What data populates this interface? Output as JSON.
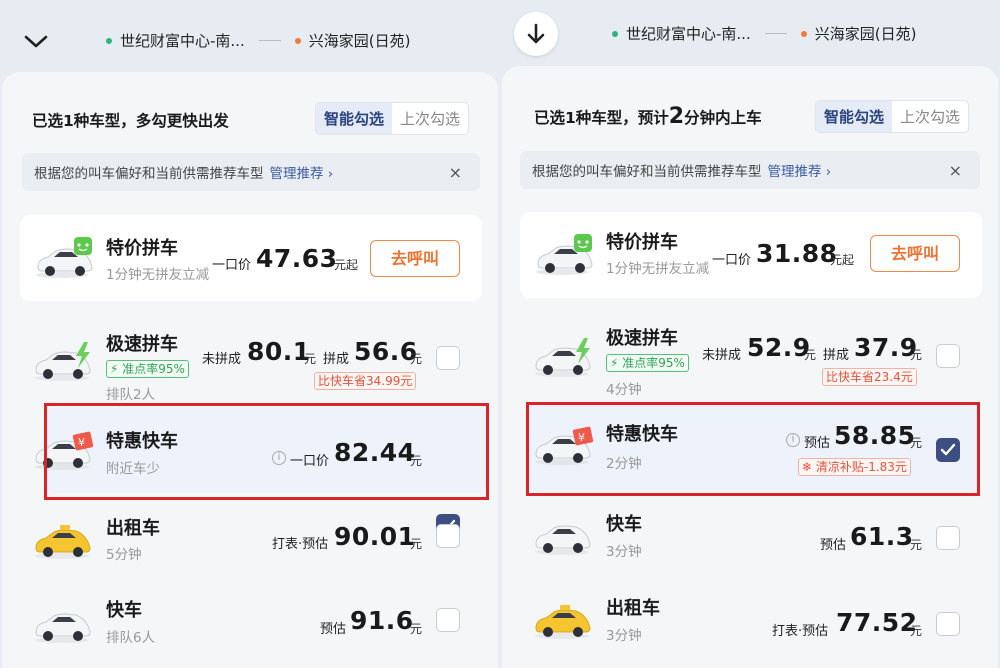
{
  "left": {
    "route": {
      "from": "世纪财富中心-南...",
      "to": "兴海家园(日苑)"
    },
    "header_text": "已选1种车型，多勾更快出发",
    "tabs": {
      "smart": "智能勾选",
      "last": "上次勾选"
    },
    "notice": {
      "text": "根据您的叫车偏好和当前供需推荐车型",
      "link": "管理推荐 ›",
      "close": "×"
    },
    "featured": {
      "name": "特价拼车",
      "sub": "1分钟无拼友立减",
      "label": "一口价",
      "price": "47.63",
      "unit": "元起",
      "button": "去呼叫"
    },
    "rows": [
      {
        "name": "极速拼车",
        "tag": "⚡ 准点率95%",
        "sub": "排队2人",
        "label1": "未拼成",
        "price1": "80.1",
        "unit1": "元",
        "label2": "拼成",
        "price2": "56.6",
        "unit2": "元",
        "save": "比快车省34.99元",
        "checked": false
      },
      {
        "name": "特惠快车",
        "sub": "附近车少",
        "label": "一口价",
        "price": "82.44",
        "unit": "元",
        "checked": true
      },
      {
        "name": "出租车",
        "sub": "5分钟",
        "label": "打表·预估",
        "price": "90.01",
        "unit": "元",
        "checked": false
      },
      {
        "name": "快车",
        "sub": "排队6人",
        "label": "预估",
        "price": "91.6",
        "unit": "元",
        "checked": false
      }
    ]
  },
  "right": {
    "route": {
      "from": "世纪财富中心-南...",
      "to": "兴海家园(日苑)"
    },
    "header_pre": "已选1种车型，预计",
    "header_num": "2",
    "header_post": "分钟内上车",
    "tabs": {
      "smart": "智能勾选",
      "last": "上次勾选"
    },
    "notice": {
      "text": "根据您的叫车偏好和当前供需推荐车型",
      "link": "管理推荐 ›",
      "close": "×"
    },
    "featured": {
      "name": "特价拼车",
      "sub": "1分钟无拼友立减",
      "label": "一口价",
      "price": "31.88",
      "unit": "元起",
      "button": "去呼叫"
    },
    "rows": [
      {
        "name": "极速拼车",
        "tag": "⚡ 准点率95%",
        "sub": "4分钟",
        "label1": "未拼成",
        "price1": "52.9",
        "unit1": "元",
        "label2": "拼成",
        "price2": "37.9",
        "unit2": "元",
        "save": "比快车省23.4元",
        "checked": false
      },
      {
        "name": "特惠快车",
        "sub": "2分钟",
        "label": "预估",
        "price": "58.85",
        "unit": "元",
        "subsidy": "❄ 清凉补贴-1.83元",
        "checked": true
      },
      {
        "name": "快车",
        "sub": "3分钟",
        "label": "预估",
        "price": "61.3",
        "unit": "元",
        "checked": false
      },
      {
        "name": "出租车",
        "sub": "3分钟",
        "label": "打表·预估",
        "price": "77.52",
        "unit": "元",
        "checked": false
      }
    ]
  },
  "colors": {
    "accent_blue": "#3d4e83",
    "orange": "#ef7330",
    "highlight_red": "#d9242a",
    "green": "#33a35a"
  }
}
